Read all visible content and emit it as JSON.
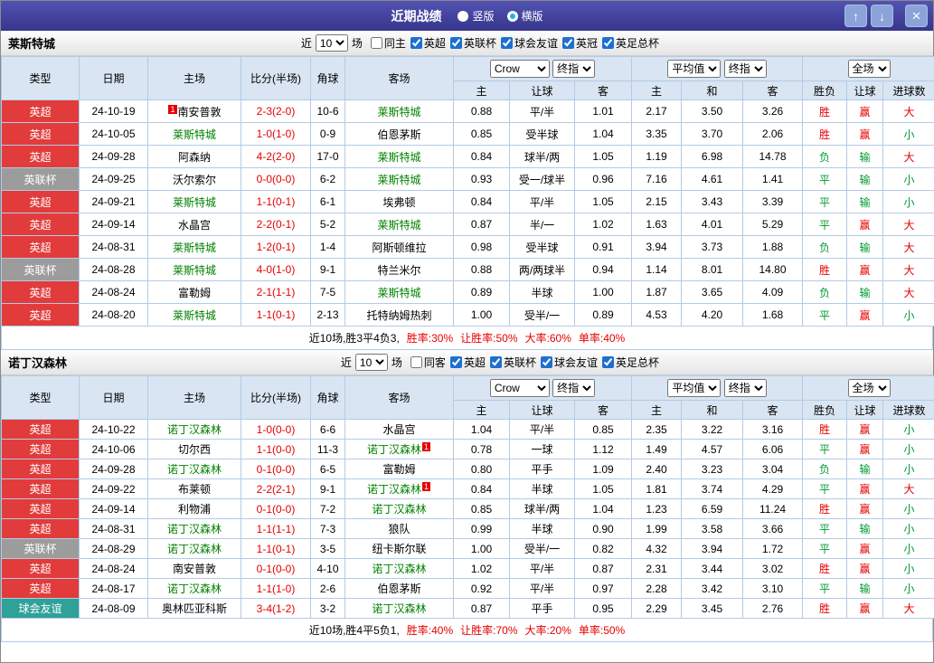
{
  "window": {
    "title": "近期战绩",
    "layout_radios": [
      {
        "key": "vertical",
        "label": "竖版",
        "selected": false
      },
      {
        "key": "horizontal",
        "label": "横版",
        "selected": true
      }
    ],
    "buttons": {
      "up": "↑",
      "down": "↓",
      "close": "×"
    }
  },
  "table_config": {
    "filter": {
      "near": "近",
      "games": "场"
    },
    "columns": {
      "type": "类型",
      "date": "日期",
      "home": "主场",
      "score": "比分(半场)",
      "corner": "角球",
      "away": "客场"
    },
    "sub_columns": [
      "主",
      "让球",
      "客",
      "主",
      "和",
      "客",
      "胜负",
      "让球",
      "进球数"
    ],
    "selects": {
      "bookmaker": "Crow",
      "asian_type": "终指",
      "euro_avg": "平均值",
      "euro_type": "终指",
      "scope": "全场"
    }
  },
  "colors": {
    "competition": {
      "英超": "#e23b3b",
      "英联杯": "#9c9c9c",
      "球会友谊": "#2fa198"
    },
    "subject_team": "#008000",
    "score": "#e60000",
    "positive": "#e60000",
    "negative": "#009933",
    "header_bg": "#d9e5f2",
    "titlebar_bg": "#3c3c96",
    "result_map": {
      "胜": "pos",
      "平": "neg",
      "负": "neg",
      "赢": "pos",
      "输": "neg",
      "大": "pos",
      "小": "neg"
    }
  },
  "sections": [
    {
      "team": "莱斯特城",
      "filter_count": "10",
      "filter_checkboxes": [
        {
          "label": "同主",
          "checked": false
        },
        {
          "label": "英超",
          "checked": true
        },
        {
          "label": "英联杯",
          "checked": true
        },
        {
          "label": "球会友谊",
          "checked": true
        },
        {
          "label": "英冠",
          "checked": true
        },
        {
          "label": "英足总杯",
          "checked": true
        }
      ],
      "rows": [
        {
          "type": "英超",
          "date": "24-10-19",
          "home": {
            "name": "南安普敦",
            "badge": "1",
            "badge_pos": "before"
          },
          "score": "2-3(2-0)",
          "corner": "10-6",
          "away": {
            "name": "莱斯特城",
            "subject": true
          },
          "asian": [
            "0.88",
            "平/半",
            "1.01"
          ],
          "euro": [
            "2.17",
            "3.50",
            "3.26"
          ],
          "result": "胜",
          "handicap": "赢",
          "goals": "大"
        },
        {
          "type": "英超",
          "date": "24-10-05",
          "home": {
            "name": "莱斯特城",
            "subject": true
          },
          "score": "1-0(1-0)",
          "corner": "0-9",
          "away": {
            "name": "伯恩茅斯"
          },
          "asian": [
            "0.85",
            "受半球",
            "1.04"
          ],
          "euro": [
            "3.35",
            "3.70",
            "2.06"
          ],
          "result": "胜",
          "handicap": "赢",
          "goals": "小"
        },
        {
          "type": "英超",
          "date": "24-09-28",
          "home": {
            "name": "阿森纳"
          },
          "score": "4-2(2-0)",
          "corner": "17-0",
          "away": {
            "name": "莱斯特城",
            "subject": true
          },
          "asian": [
            "0.84",
            "球半/两",
            "1.05"
          ],
          "euro": [
            "1.19",
            "6.98",
            "14.78"
          ],
          "result": "负",
          "handicap": "输",
          "goals": "大"
        },
        {
          "type": "英联杯",
          "date": "24-09-25",
          "home": {
            "name": "沃尔索尔"
          },
          "score": "0-0(0-0)",
          "corner": "6-2",
          "away": {
            "name": "莱斯特城",
            "subject": true
          },
          "asian": [
            "0.93",
            "受一/球半",
            "0.96"
          ],
          "euro": [
            "7.16",
            "4.61",
            "1.41"
          ],
          "result": "平",
          "handicap": "输",
          "goals": "小"
        },
        {
          "type": "英超",
          "date": "24-09-21",
          "home": {
            "name": "莱斯特城",
            "subject": true
          },
          "score": "1-1(0-1)",
          "corner": "6-1",
          "away": {
            "name": "埃弗顿"
          },
          "asian": [
            "0.84",
            "平/半",
            "1.05"
          ],
          "euro": [
            "2.15",
            "3.43",
            "3.39"
          ],
          "result": "平",
          "handicap": "输",
          "goals": "小"
        },
        {
          "type": "英超",
          "date": "24-09-14",
          "home": {
            "name": "水晶宫"
          },
          "score": "2-2(0-1)",
          "corner": "5-2",
          "away": {
            "name": "莱斯特城",
            "subject": true
          },
          "asian": [
            "0.87",
            "半/一",
            "1.02"
          ],
          "euro": [
            "1.63",
            "4.01",
            "5.29"
          ],
          "result": "平",
          "handicap": "赢",
          "goals": "大"
        },
        {
          "type": "英超",
          "date": "24-08-31",
          "home": {
            "name": "莱斯特城",
            "subject": true
          },
          "score": "1-2(0-1)",
          "corner": "1-4",
          "away": {
            "name": "阿斯顿维拉"
          },
          "asian": [
            "0.98",
            "受半球",
            "0.91"
          ],
          "euro": [
            "3.94",
            "3.73",
            "1.88"
          ],
          "result": "负",
          "handicap": "输",
          "goals": "大"
        },
        {
          "type": "英联杯",
          "date": "24-08-28",
          "home": {
            "name": "莱斯特城",
            "subject": true
          },
          "score": "4-0(1-0)",
          "corner": "9-1",
          "away": {
            "name": "特兰米尔"
          },
          "asian": [
            "0.88",
            "两/两球半",
            "0.94"
          ],
          "euro": [
            "1.14",
            "8.01",
            "14.80"
          ],
          "result": "胜",
          "handicap": "赢",
          "goals": "大"
        },
        {
          "type": "英超",
          "date": "24-08-24",
          "home": {
            "name": "富勒姆"
          },
          "score": "2-1(1-1)",
          "corner": "7-5",
          "away": {
            "name": "莱斯特城",
            "subject": true
          },
          "asian": [
            "0.89",
            "半球",
            "1.00"
          ],
          "euro": [
            "1.87",
            "3.65",
            "4.09"
          ],
          "result": "负",
          "handicap": "输",
          "goals": "大"
        },
        {
          "type": "英超",
          "date": "24-08-20",
          "home": {
            "name": "莱斯特城",
            "subject": true
          },
          "score": "1-1(0-1)",
          "corner": "2-13",
          "away": {
            "name": "托特纳姆热刺"
          },
          "asian": [
            "1.00",
            "受半/一",
            "0.89"
          ],
          "euro": [
            "4.53",
            "4.20",
            "1.68"
          ],
          "result": "平",
          "handicap": "赢",
          "goals": "小"
        }
      ],
      "summary": {
        "record": "近10场,胜3平4负3,",
        "stats": [
          "胜率:30%",
          "让胜率:50%",
          "大率:60%",
          "单率:40%"
        ]
      }
    },
    {
      "team": "诺丁汉森林",
      "filter_count": "10",
      "filter_checkboxes": [
        {
          "label": "同客",
          "checked": false
        },
        {
          "label": "英超",
          "checked": true
        },
        {
          "label": "英联杯",
          "checked": true
        },
        {
          "label": "球会友谊",
          "checked": true
        },
        {
          "label": "英足总杯",
          "checked": true
        }
      ],
      "rows": [
        {
          "type": "英超",
          "date": "24-10-22",
          "home": {
            "name": "诺丁汉森林",
            "subject": true
          },
          "score": "1-0(0-0)",
          "corner": "6-6",
          "away": {
            "name": "水晶宫"
          },
          "asian": [
            "1.04",
            "平/半",
            "0.85"
          ],
          "euro": [
            "2.35",
            "3.22",
            "3.16"
          ],
          "result": "胜",
          "handicap": "赢",
          "goals": "小"
        },
        {
          "type": "英超",
          "date": "24-10-06",
          "home": {
            "name": "切尔西"
          },
          "score": "1-1(0-0)",
          "corner": "11-3",
          "away": {
            "name": "诺丁汉森林",
            "subject": true,
            "badge": "1",
            "badge_pos": "after"
          },
          "asian": [
            "0.78",
            "一球",
            "1.12"
          ],
          "euro": [
            "1.49",
            "4.57",
            "6.06"
          ],
          "result": "平",
          "handicap": "赢",
          "goals": "小"
        },
        {
          "type": "英超",
          "date": "24-09-28",
          "home": {
            "name": "诺丁汉森林",
            "subject": true
          },
          "score": "0-1(0-0)",
          "corner": "6-5",
          "away": {
            "name": "富勒姆"
          },
          "asian": [
            "0.80",
            "平手",
            "1.09"
          ],
          "euro": [
            "2.40",
            "3.23",
            "3.04"
          ],
          "result": "负",
          "handicap": "输",
          "goals": "小"
        },
        {
          "type": "英超",
          "date": "24-09-22",
          "home": {
            "name": "布莱顿"
          },
          "score": "2-2(2-1)",
          "corner": "9-1",
          "away": {
            "name": "诺丁汉森林",
            "subject": true,
            "badge": "1",
            "badge_pos": "after"
          },
          "asian": [
            "0.84",
            "半球",
            "1.05"
          ],
          "euro": [
            "1.81",
            "3.74",
            "4.29"
          ],
          "result": "平",
          "handicap": "赢",
          "goals": "大"
        },
        {
          "type": "英超",
          "date": "24-09-14",
          "home": {
            "name": "利物浦"
          },
          "score": "0-1(0-0)",
          "corner": "7-2",
          "away": {
            "name": "诺丁汉森林",
            "subject": true
          },
          "asian": [
            "0.85",
            "球半/两",
            "1.04"
          ],
          "euro": [
            "1.23",
            "6.59",
            "11.24"
          ],
          "result": "胜",
          "handicap": "赢",
          "goals": "小"
        },
        {
          "type": "英超",
          "date": "24-08-31",
          "home": {
            "name": "诺丁汉森林",
            "subject": true
          },
          "score": "1-1(1-1)",
          "corner": "7-3",
          "away": {
            "name": "狼队"
          },
          "asian": [
            "0.99",
            "半球",
            "0.90"
          ],
          "euro": [
            "1.99",
            "3.58",
            "3.66"
          ],
          "result": "平",
          "handicap": "输",
          "goals": "小"
        },
        {
          "type": "英联杯",
          "date": "24-08-29",
          "home": {
            "name": "诺丁汉森林",
            "subject": true
          },
          "score": "1-1(0-1)",
          "corner": "3-5",
          "away": {
            "name": "纽卡斯尔联"
          },
          "asian": [
            "1.00",
            "受半/一",
            "0.82"
          ],
          "euro": [
            "4.32",
            "3.94",
            "1.72"
          ],
          "result": "平",
          "handicap": "赢",
          "goals": "小"
        },
        {
          "type": "英超",
          "date": "24-08-24",
          "home": {
            "name": "南安普敦"
          },
          "score": "0-1(0-0)",
          "corner": "4-10",
          "away": {
            "name": "诺丁汉森林",
            "subject": true
          },
          "asian": [
            "1.02",
            "平/半",
            "0.87"
          ],
          "euro": [
            "2.31",
            "3.44",
            "3.02"
          ],
          "result": "胜",
          "handicap": "赢",
          "goals": "小"
        },
        {
          "type": "英超",
          "date": "24-08-17",
          "home": {
            "name": "诺丁汉森林",
            "subject": true
          },
          "score": "1-1(1-0)",
          "corner": "2-6",
          "away": {
            "name": "伯恩茅斯"
          },
          "asian": [
            "0.92",
            "平/半",
            "0.97"
          ],
          "euro": [
            "2.28",
            "3.42",
            "3.10"
          ],
          "result": "平",
          "handicap": "输",
          "goals": "小"
        },
        {
          "type": "球会友谊",
          "date": "24-08-09",
          "home": {
            "name": "奥林匹亚科斯"
          },
          "score": "3-4(1-2)",
          "corner": "3-2",
          "away": {
            "name": "诺丁汉森林",
            "subject": true
          },
          "asian": [
            "0.87",
            "平手",
            "0.95"
          ],
          "euro": [
            "2.29",
            "3.45",
            "2.76"
          ],
          "result": "胜",
          "handicap": "赢",
          "goals": "大"
        }
      ],
      "summary": {
        "record": "近10场,胜4平5负1,",
        "stats": [
          "胜率:40%",
          "让胜率:70%",
          "大率:20%",
          "单率:50%"
        ]
      }
    }
  ]
}
